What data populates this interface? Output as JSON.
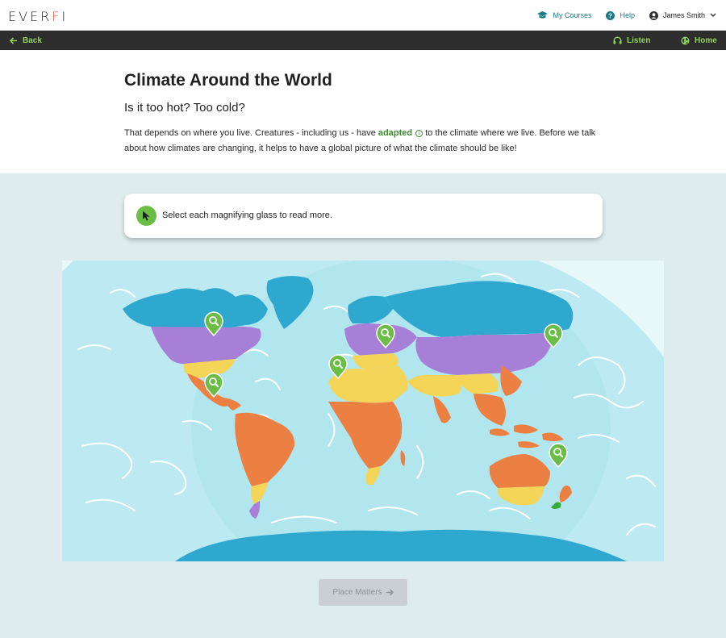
{
  "header": {
    "logo_pre": "EVER",
    "logo_accent": "F",
    "logo_post": "I",
    "nav": {
      "my_courses": "My Courses",
      "help": "Help",
      "user_name": "James Smith"
    }
  },
  "navbar": {
    "back": "Back",
    "listen": "Listen",
    "home": "Home"
  },
  "intro": {
    "title": "Climate Around the World",
    "subtitle": "Is it too hot? Too cold?",
    "para_before": "That depends on where you live. Creatures - including us - have ",
    "para_keyword": "adapted",
    "para_after": " to the climate where we live. Before we talk about how climates are changing, it helps to have a global picture of what the climate should be like!"
  },
  "instruction": {
    "text": "Select each magnifying glass to read more."
  },
  "map": {
    "pins": [
      "pin-north-america-north",
      "pin-north-america-south",
      "pin-europe-west",
      "pin-europe-north",
      "pin-east-asia",
      "pin-oceania"
    ]
  },
  "cta": {
    "label": "Place Matters"
  },
  "colors": {
    "accent_green": "#6bbd45",
    "link_teal": "#1c7a86",
    "zone_polar": "#2fa8d0",
    "zone_temperate": "#a87fd6",
    "zone_arid": "#f4d558",
    "zone_tropical": "#ec8043",
    "ocean": "#b9ebf2"
  }
}
